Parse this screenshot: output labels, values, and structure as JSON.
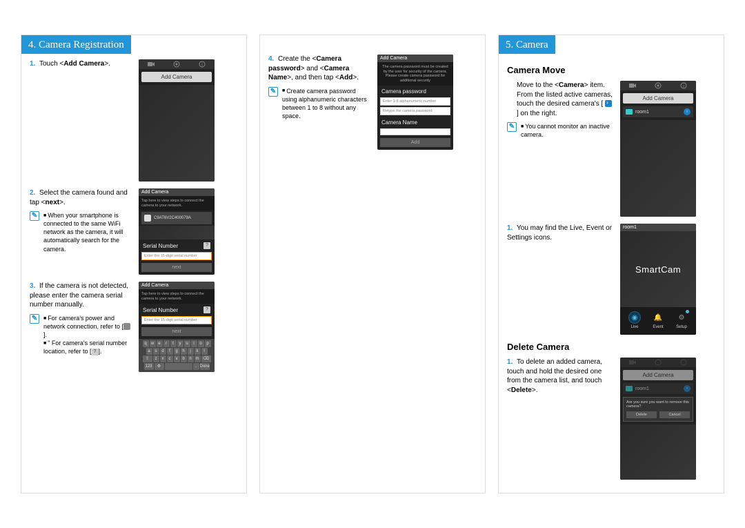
{
  "panel1": {
    "header": "4. Camera Registration",
    "step1_num": "1.",
    "step1_text_a": "Touch <",
    "step1_text_b": "Add Camera",
    "step1_text_c": ">.",
    "step2_num": "2.",
    "step2_text_a": "Select the camera found and tap <",
    "step2_text_b": "next",
    "step2_text_c": ">.",
    "note2_text": "When your smartphone is connected to the same WiFi network as the camera, it will automatically search for the camera.",
    "step3_num": "3.",
    "step3_text": "If the camera is not detected, please enter the camera serial number manually.",
    "note3a_text": "For camera's power and network connection, refer to [",
    "note3a_end": "].",
    "note3b_text": "\" For camera's serial number location, refer to [",
    "note3b_end": "].",
    "phone1": {
      "tab_camera": "Camera",
      "tab_setup": "Setup",
      "tab_info": "Info",
      "add_camera": "Add Camera"
    },
    "phone2": {
      "header": "Add Camera",
      "help": "Tap here to view steps to connect the camera to your network.",
      "cam_id": "C9AT6V2C400079A",
      "serial_label": "Serial Number",
      "input_placeholder": "Enter the 15-digit serial number",
      "next": "next"
    },
    "phone3": {
      "header": "Add Camera",
      "help": "Tap here to view steps to connect the camera to your network.",
      "serial_label": "Serial Number",
      "input_placeholder": "Enter the 15-digit serial number",
      "next": "next",
      "kb_r1": "q w e r t y u i o p",
      "kb_r2": "a s d f g h j k l",
      "kb_r4_done": "Done"
    }
  },
  "panel2": {
    "step4_num": "4.",
    "step4_text_a": "Create the <",
    "step4_text_b": "Camera password",
    "step4_text_c": "> and <",
    "step4_text_d": "Camera Name",
    "step4_text_e": ">, and then tap <",
    "step4_text_f": "Add",
    "step4_text_g": ">.",
    "note4_text": "Create camera password using alphanumeric characters between 1 to 8 without any space.",
    "phone4": {
      "header": "Add Camera",
      "help": "The camera password must be created by the user for security of the camera. Please create camera password for additional security",
      "pw_label": "Camera password",
      "pw_placeholder": "Enter 1-8 alphanumeric number",
      "pw_retype": "Retype the camera password",
      "name_label": "Camera Name",
      "add_btn": "Add"
    }
  },
  "panel3": {
    "header": "5. Camera",
    "move_title": "Camera Move",
    "move_text_a": "Move to the <",
    "move_text_b": "Camera",
    "move_text_c": "> item. From the listed active cameras, touch the desired camera's [",
    "move_text_d": "] on the right.",
    "move_note": "You cannot monitor an inactive camera.",
    "step1_num": "1.",
    "step1_text": "You may find the Live, Event or Settings icons.",
    "delete_title": "Delete Camera",
    "del_num": "1.",
    "del_text_a": "To delete an added camera, touch and hold the desired one from the camera list, and touch <",
    "del_text_b": "Delete",
    "del_text_c": ">.",
    "phone5": {
      "tab_camera": "Camera",
      "tab_setup": "Setup",
      "tab_info": "Info",
      "add_camera": "Add Camera",
      "room": "room1"
    },
    "phone6": {
      "header": "room1",
      "brand_a": "Smart",
      "brand_b": "Cam",
      "live": "Live",
      "event": "Event",
      "setup": "Setup"
    },
    "phone7": {
      "add_camera": "Add Camera",
      "room": "room1",
      "dialog": "Are you sure you want to remove this camera?",
      "delete": "Delete",
      "cancel": "Cancel"
    }
  }
}
